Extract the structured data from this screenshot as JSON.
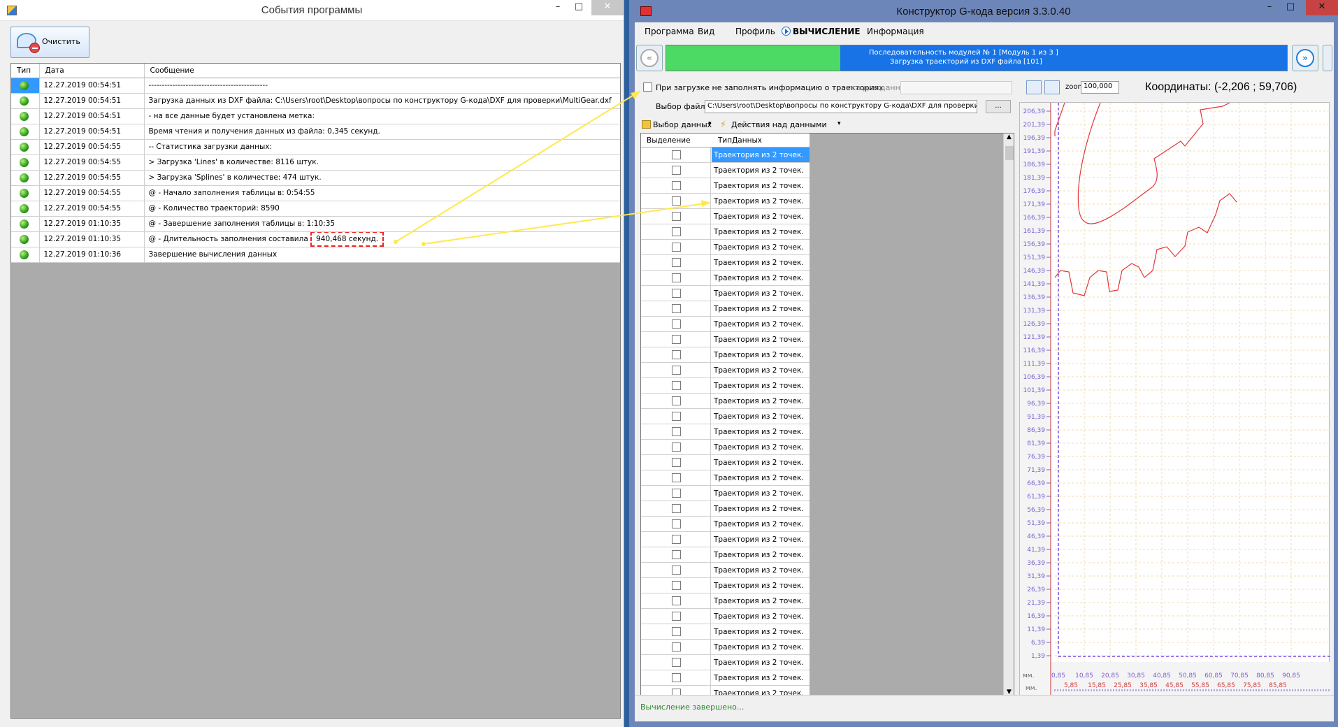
{
  "events_window": {
    "title": "События программы",
    "clear_button": "Очистить",
    "columns": [
      "Тип",
      "Дата",
      "Сообщение"
    ],
    "rows": [
      {
        "date": "12.27.2019 00:54:51",
        "message": "---------------------------------------------"
      },
      {
        "date": "12.27.2019 00:54:51",
        "message": "Загрузка данных из DXF файла: C:\\Users\\root\\Desktop\\вопросы по конструктору G-кода\\DXF для проверки\\MultiGear.dxf"
      },
      {
        "date": "12.27.2019 00:54:51",
        "message": "- на все данные будет установлена метка:"
      },
      {
        "date": "12.27.2019 00:54:51",
        "message": "Время чтения и получения данных из файла: 0,345 секунд."
      },
      {
        "date": "12.27.2019 00:54:55",
        "message": "-- Статистика загрузки данных:"
      },
      {
        "date": "12.27.2019 00:54:55",
        "message": "> Загрузка 'Lines' в количестве: 8116 штук."
      },
      {
        "date": "12.27.2019 00:54:55",
        "message": "> Загрузка 'Splines' в количестве: 474 штук."
      },
      {
        "date": "12.27.2019 00:54:55",
        "message": "@ - Начало заполнения таблицы в: 0:54:55"
      },
      {
        "date": "12.27.2019 00:54:55",
        "message": "@ - Количество траекторий: 8590"
      },
      {
        "date": "12.27.2019 01:10:35",
        "message": "@ - Завершение заполнения таблицы в: 1:10:35"
      },
      {
        "date": "12.27.2019 01:10:35",
        "message": "@ - Длительность заполнения составила",
        "highlight": "940,468 секунд."
      },
      {
        "date": "12.27.2019 01:10:36",
        "message": "Завершение вычисления данных"
      }
    ]
  },
  "gcode_window": {
    "title": "Конструктор G-кода версия 3.3.0.40",
    "menu": [
      "Программа",
      "Вид",
      "Профиль",
      "ВЫЧИСЛЕНИЕ",
      "Информация"
    ],
    "progress_text_1": "Последовательность модулей № 1 [Модуль 1 из 3 ]",
    "progress_text_2": "Загрузка траекторий из DXF файла [101]",
    "progress_value": 0.28,
    "option_checkbox": "При загрузке не заполнять информацию о траекториях",
    "option_hint": "тка для данных:",
    "file_label": "Выбор файла:",
    "file_path": "C:\\Users\\root\\Desktop\\вопросы по конструктору G-кода\\DXF для проверки",
    "browse_button": "...",
    "select_data": "Выбор данных",
    "actions": "Действия над данными",
    "zoom_label": "zoom",
    "zoom_value": "100,000",
    "coords": "Координаты: (-2,206 ; 59,706)",
    "grid_columns": [
      "Выделение",
      "ТипДанных"
    ],
    "row_label": "Траектория из 2 точек.",
    "row_count": 36,
    "status": "Вычисление завершено...",
    "y_ticks": [
      "206,39",
      "201,39",
      "196,39",
      "191,39",
      "186,39",
      "181,39",
      "176,39",
      "171,39",
      "166,39",
      "161,39",
      "156,39",
      "151,39",
      "146,39",
      "141,39",
      "136,39",
      "131,39",
      "126,39",
      "121,39",
      "116,39",
      "111,39",
      "106,39",
      "101,39",
      "96,39",
      "91,39",
      "86,39",
      "81,39",
      "76,39",
      "71,39",
      "66,39",
      "61,39",
      "56,39",
      "51,39",
      "46,39",
      "41,39",
      "36,39",
      "31,39",
      "26,39",
      "21,39",
      "16,39",
      "11,39",
      "6,39",
      "1,39"
    ],
    "x_ticks_top": [
      "0,85",
      "10,85",
      "20,85",
      "30,85",
      "40,85",
      "50,85",
      "60,85",
      "70,85",
      "80,85",
      "90,85"
    ],
    "x_ticks_bottom": [
      "5,85",
      "15,85",
      "25,85",
      "35,85",
      "45,85",
      "55,85",
      "65,85",
      "75,85",
      "85,85"
    ],
    "unit": "мм."
  }
}
